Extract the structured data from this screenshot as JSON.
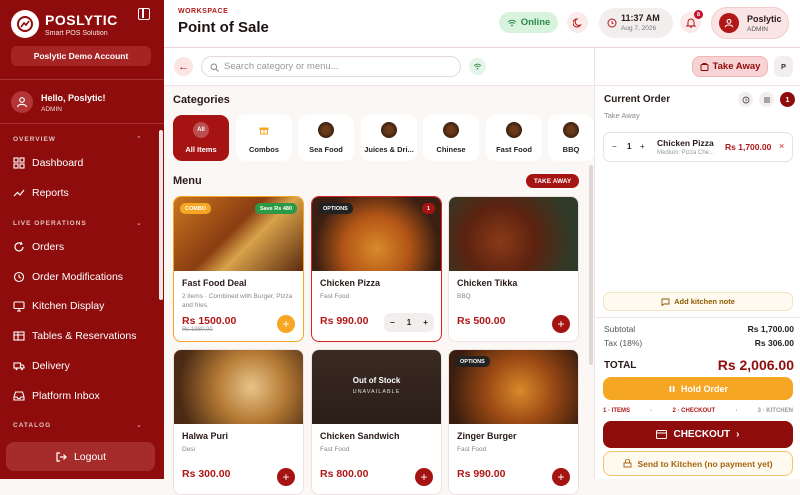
{
  "sidebar": {
    "brand": "POSLYTIC",
    "brand_sub": "Smart POS Solution",
    "account": "Poslytic Demo Account",
    "user_greeting": "Hello, Poslytic!",
    "user_role": "ADMIN",
    "sections": {
      "overview": "OVERVIEW",
      "live": "LIVE OPERATIONS",
      "catalog": "CATALOG"
    },
    "items": [
      {
        "label": "Dashboard",
        "icon": "grid-icon"
      },
      {
        "label": "Reports",
        "icon": "trend-icon"
      },
      {
        "label": "Orders",
        "icon": "refresh-icon"
      },
      {
        "label": "Order Modifications",
        "icon": "history-icon"
      },
      {
        "label": "Kitchen Display",
        "icon": "monitor-icon"
      },
      {
        "label": "Tables & Reservations",
        "icon": "table-icon"
      },
      {
        "label": "Delivery",
        "icon": "truck-icon"
      },
      {
        "label": "Platform Inbox",
        "icon": "inbox-icon"
      }
    ],
    "logout": "Logout"
  },
  "header": {
    "workspace": "WORKSPACE",
    "title": "Point of Sale",
    "status": "Online",
    "time": "11:37 AM",
    "date": "Aug 7, 2026",
    "notifications": "8",
    "profile_name": "Poslytic",
    "profile_role": "ADMIN"
  },
  "search": {
    "placeholder": "Search category or menu..."
  },
  "mode": {
    "takeaway": "Take Away",
    "p": "P"
  },
  "categories": {
    "title": "Categories",
    "all_badge": "All",
    "items": [
      "All Items",
      "Combos",
      "Sea Food",
      "Juices & Dri...",
      "Chinese",
      "Fast Food",
      "BBQ"
    ]
  },
  "menu": {
    "title": "Menu",
    "badge": "TAKE AWAY",
    "items": [
      {
        "name": "Fast Food Deal",
        "sub": "2 items · Combined with Burger, Pizza and fries.",
        "price": "Rs 1500.00",
        "old": "Rs 1980.00",
        "tag1": "COMBO",
        "tag2": "Save Rs 480"
      },
      {
        "name": "Chicken Pizza",
        "sub": "Fast Food",
        "price": "Rs 990.00",
        "tag1": "OPTIONS",
        "qty": "1",
        "count": "1"
      },
      {
        "name": "Chicken Tikka",
        "sub": "BBQ",
        "price": "Rs 500.00"
      },
      {
        "name": "Halwa Puri",
        "sub": "Desi",
        "price": "Rs 300.00"
      },
      {
        "name": "Chicken Sandwich",
        "sub": "Fast Food",
        "price": "Rs 800.00",
        "oos": "Out of Stock",
        "oos_sub": "UNAVAILABLE"
      },
      {
        "name": "Zinger Burger",
        "sub": "Fast Food",
        "price": "Rs 990.00",
        "tag1": "OPTIONS"
      }
    ]
  },
  "order": {
    "title": "Current Order",
    "mode": "Take Away",
    "count": "1",
    "item": {
      "qty": "1",
      "name": "Chicken Pizza",
      "detail": "Medium: Pizza Che...",
      "price": "Rs 1,700.00"
    },
    "note": "Add kitchen note",
    "subtotal_label": "Subtotal",
    "subtotal": "Rs 1,700.00",
    "tax_label": "Tax (18%)",
    "tax": "Rs 306.00",
    "total_label": "TOTAL",
    "total": "Rs 2,006.00",
    "hold": "Hold Order",
    "steps": [
      "1 · ITEMS",
      "2 · CHECKOUT",
      "3 · KITCHEN"
    ],
    "checkout": "CHECKOUT",
    "kitchen": "Send to Kitchen (no payment yet)"
  },
  "colors": {
    "primary": "#8e0c0c",
    "accent": "#f5a623",
    "online": "#2c8a45"
  }
}
